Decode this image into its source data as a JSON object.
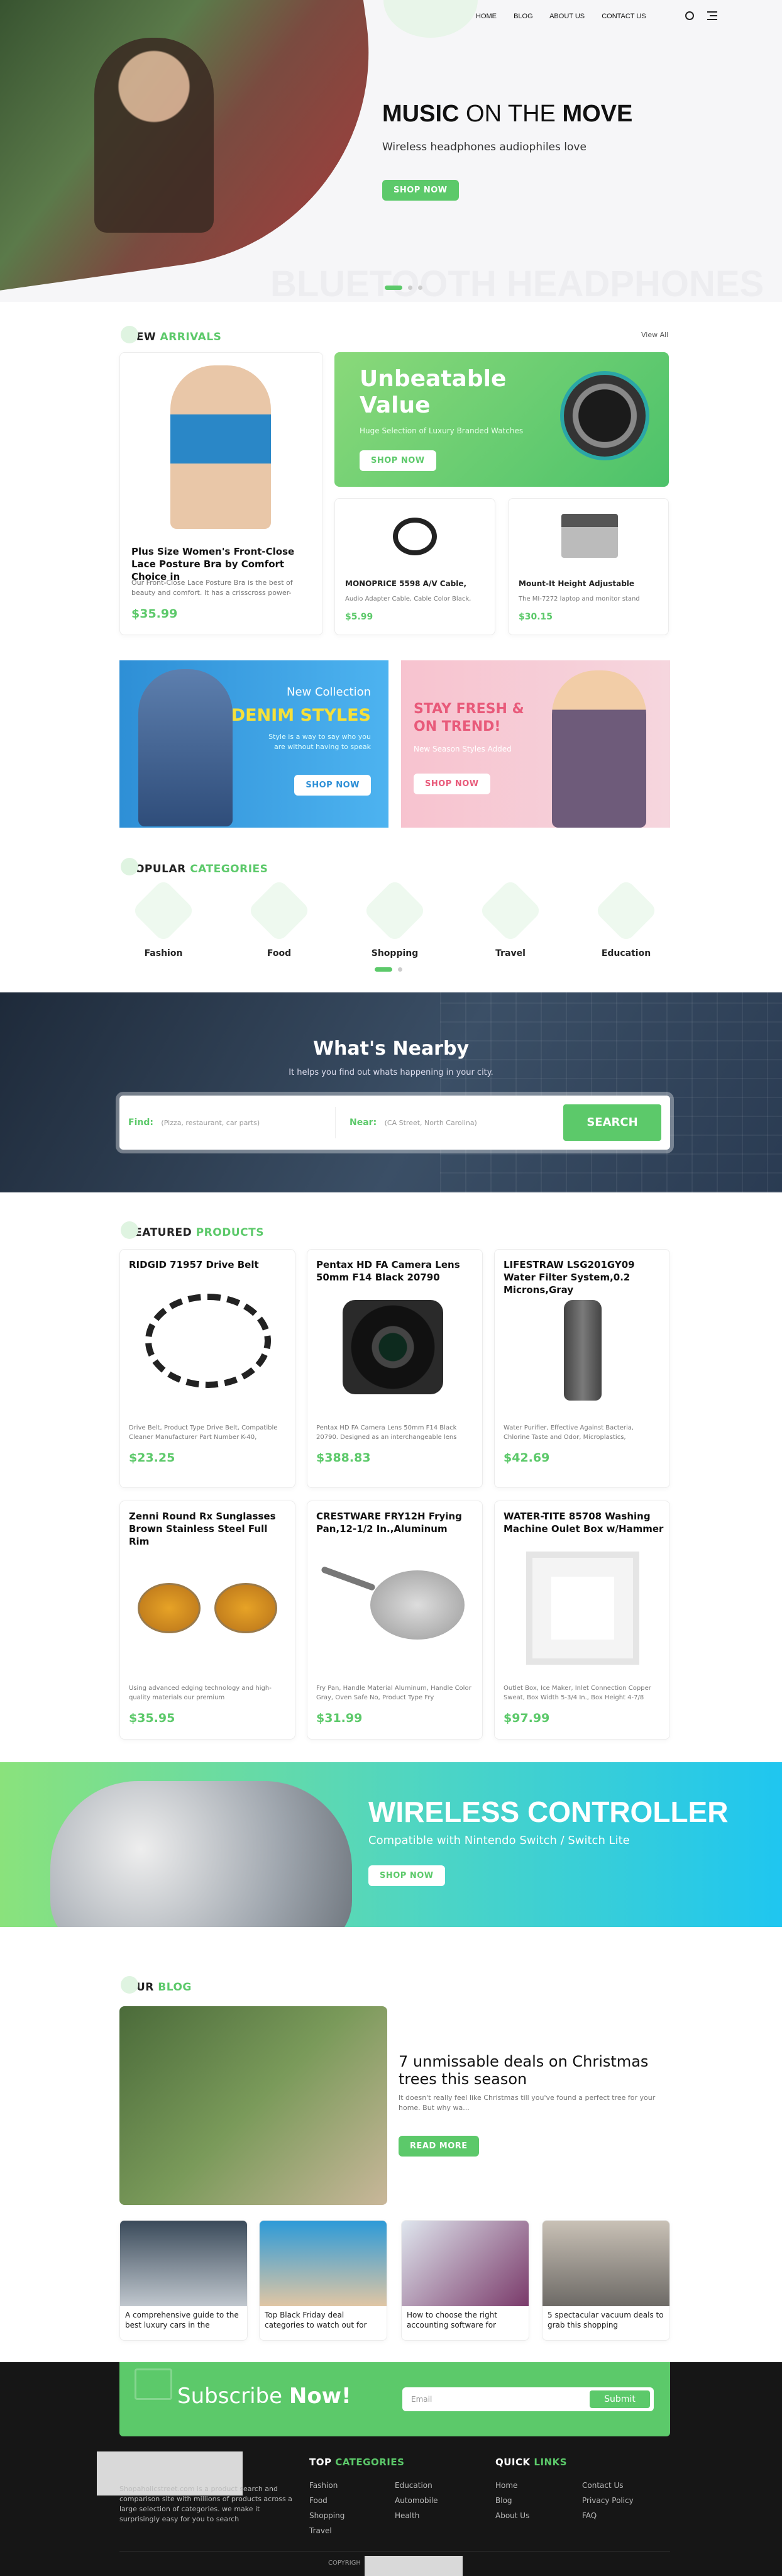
{
  "nav": {
    "links": [
      "HOME",
      "BLOG",
      "ABOUT US",
      "CONTACT US"
    ]
  },
  "hero": {
    "title_bold": "MUSIC",
    "title_light": "ON THE",
    "title_bold2": "MOVE",
    "subtitle": "Wireless headphones audiophiles love",
    "cta": "SHOP NOW",
    "watermark": "BLUETOOTH HEADPHONES"
  },
  "new_arrivals": {
    "title_a": "NEW",
    "title_b": "ARRIVALS",
    "view_all": "View All",
    "featured": {
      "title": "Plus Size Women's Front-Close Lace Posture Bra by Comfort Choice in",
      "desc": "Our Front-Close Lace Posture Bra is the best of beauty and comfort. It has a crisscross power-",
      "price": "$35.99"
    },
    "promo": {
      "title": "Unbeatable Value",
      "subtitle": "Huge Selection of Luxury Branded Watches",
      "cta": "SHOP NOW"
    },
    "small": [
      {
        "title": "MONOPRICE 5598 A/V Cable,",
        "desc": "Audio Adapter Cable, Cable Color Black,",
        "price": "$5.99"
      },
      {
        "title": "Mount-It Height Adjustable",
        "desc": "The MI-7272 laptop and monitor stand",
        "price": "$30.15"
      }
    ]
  },
  "banners": {
    "denim": {
      "eyebrow": "New Collection",
      "title": "DENIM STYLES",
      "desc": "Style is a way to say who you are without having to speak",
      "cta": "SHOP NOW"
    },
    "fresh": {
      "title": "STAY FRESH & ON TREND!",
      "desc": "New Season Styles Added",
      "cta": "SHOP NOW"
    }
  },
  "categories": {
    "title_a": "POPULAR",
    "title_b": "CATEGORIES",
    "items": [
      "Fashion",
      "Food",
      "Shopping",
      "Travel",
      "Education"
    ]
  },
  "nearby": {
    "title": "What's Nearby",
    "subtitle": "It helps you find out whats happening in your city.",
    "find_label": "Find:",
    "find_placeholder": "(Pizza, restaurant, car parts)",
    "near_label": "Near:",
    "near_placeholder": "(CA Street, North Carolina)",
    "cta": "SEARCH"
  },
  "featured": {
    "title_a": "FEATURED",
    "title_b": "PRODUCTS",
    "items": [
      {
        "title": "RIDGID 71957 Drive Belt",
        "desc": "Drive Belt, Product Type Drive Belt, Compatible Cleaner Manufacturer Part Number K-40,",
        "price": "$23.25"
      },
      {
        "title": "Pentax HD FA Camera Lens 50mm F14 Black 20790",
        "desc": "Pentax HD FA Camera Lens 50mm F14 Black 20790. Designed as an interchangeable lens",
        "price": "$388.83"
      },
      {
        "title": "LIFESTRAW LSG201GY09 Water Filter System,0.2 Microns,Gray",
        "desc": "Water Purifier, Effective Against Bacteria, Chlorine Taste and Odor, Microplastics,",
        "price": "$42.69"
      },
      {
        "title": "Zenni Round Rx Sunglasses Brown Stainless Steel Full Rim",
        "desc": "Using advanced edging technology and high-quality materials our premium",
        "price": "$35.95"
      },
      {
        "title": "CRESTWARE FRY12H Frying Pan,12-1/2 In.,Aluminum",
        "desc": "Fry Pan, Handle Material Aluminum, Handle Color Gray, Oven Safe No, Product Type Fry",
        "price": "$31.99"
      },
      {
        "title": "WATER-TITE 85708 Washing Machine Oulet Box w/Hammer",
        "desc": "Outlet Box, Ice Maker, Inlet Connection Copper Sweat, Box Width 5-3/4 In., Box Height 4-7/8",
        "price": "$97.99"
      }
    ]
  },
  "controller": {
    "title": "WIRELESS CONTROLLER",
    "subtitle": "Compatible with Nintendo Switch / Switch Lite",
    "cta": "SHOP NOW"
  },
  "blog": {
    "title_a": "OUR",
    "title_b": "BLOG",
    "main": {
      "title": "7 unmissable deals on Christmas trees this season",
      "desc": "It doesn't really feel like Christmas till you've found a perfect tree for your home. But why wa...",
      "cta": "READ MORE"
    },
    "posts": [
      "A comprehensive guide to the best luxury cars in the",
      "Top Black Friday deal categories to watch out for",
      "How to choose the right accounting software for",
      "5 spectacular vacuum deals to grab this shopping"
    ]
  },
  "subscribe": {
    "title_a": "Subscribe",
    "title_b": "Now!",
    "placeholder": "Email",
    "cta": "Submit"
  },
  "footer": {
    "about": "Shopaholicstreet.com is a product search and comparison site with millions of products across a large selection of categories. we make it surprisingly easy for you to search",
    "cat_title_a": "TOP",
    "cat_title_b": "CATEGORIES",
    "cats_col1": [
      "Fashion",
      "Food",
      "Shopping",
      "Travel"
    ],
    "cats_col2": [
      "Education",
      "Automobile",
      "Health"
    ],
    "links_title_a": "QUICK",
    "links_title_b": "LINKS",
    "links_col1": [
      "Home",
      "Blog",
      "About Us"
    ],
    "links_col2": [
      "Contact Us",
      "Privacy Policy",
      "FAQ"
    ],
    "copyright": "COPYRIGH"
  }
}
